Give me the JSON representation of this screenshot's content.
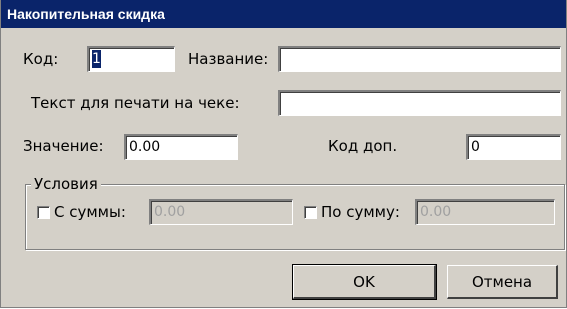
{
  "window": {
    "title": "Накопительная скидка"
  },
  "form": {
    "code": {
      "label": "Код:",
      "value": "1"
    },
    "name": {
      "label": "Название:",
      "value": ""
    },
    "receipt_text": {
      "label": "Текст для печати на чеке:",
      "value": ""
    },
    "value": {
      "label": "Значение:",
      "value": "0.00"
    },
    "extra_code": {
      "label": "Код доп.",
      "value": "0"
    }
  },
  "conditions": {
    "title": "Условия",
    "from_sum": {
      "label": "С суммы:",
      "value": "0.00",
      "checked": false
    },
    "to_sum": {
      "label": "По сумму:",
      "value": "0.00",
      "checked": false
    }
  },
  "buttons": {
    "ok": "OK",
    "cancel": "Отмена"
  },
  "colors": {
    "titlebar": "#0a246a",
    "face": "#d4d0c8",
    "selection": "#0a246a"
  }
}
